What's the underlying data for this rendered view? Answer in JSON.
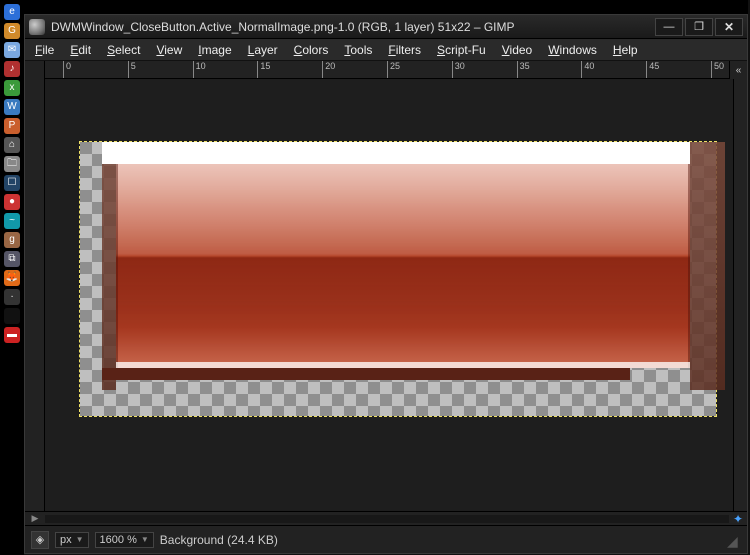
{
  "titlebar": {
    "title": "DWMWindow_CloseButton.Active_NormalImage.png-1.0 (RGB, 1 layer) 51x22 – GIMP",
    "minimize": "—",
    "maximize": "❐",
    "close": "✕"
  },
  "menubar": {
    "items": [
      "File",
      "Edit",
      "Select",
      "View",
      "Image",
      "Layer",
      "Colors",
      "Tools",
      "Filters",
      "Script-Fu",
      "Video",
      "Windows",
      "Help"
    ]
  },
  "ruler": {
    "h_ticks": [
      0,
      5,
      10,
      15,
      20,
      25,
      30,
      35,
      40,
      45,
      50
    ],
    "nav_toggle": "«"
  },
  "statusbar": {
    "unit_label": "px",
    "zoom_label": "1600 %",
    "layer_label": "Background (24.4 KB)"
  },
  "scroll": {
    "left_arrow": "▶",
    "nav": "✦"
  },
  "os_icons": [
    {
      "bg": "#2c6fd8",
      "c": "e"
    },
    {
      "bg": "#d08a2a",
      "c": "G"
    },
    {
      "bg": "#7aa8e0",
      "c": "✉"
    },
    {
      "bg": "#b03030",
      "c": "♪"
    },
    {
      "bg": "#3a9a3a",
      "c": "x"
    },
    {
      "bg": "#3a7abf",
      "c": "W"
    },
    {
      "bg": "#ca5f2d",
      "c": "P"
    },
    {
      "bg": "#555",
      "c": "⌂"
    },
    {
      "bg": "#888",
      "c": "🗀"
    },
    {
      "bg": "#246",
      "c": "☐"
    },
    {
      "bg": "#c33",
      "c": "●"
    },
    {
      "bg": "#19a",
      "c": "~"
    },
    {
      "bg": "#964",
      "c": "g"
    },
    {
      "bg": "#556",
      "c": "⧉"
    },
    {
      "bg": "#e06a18",
      "c": "🦊"
    },
    {
      "bg": "#333",
      "c": "∙"
    },
    {
      "bg": "#111",
      "c": " "
    },
    {
      "bg": "#c22",
      "c": "▬"
    }
  ]
}
